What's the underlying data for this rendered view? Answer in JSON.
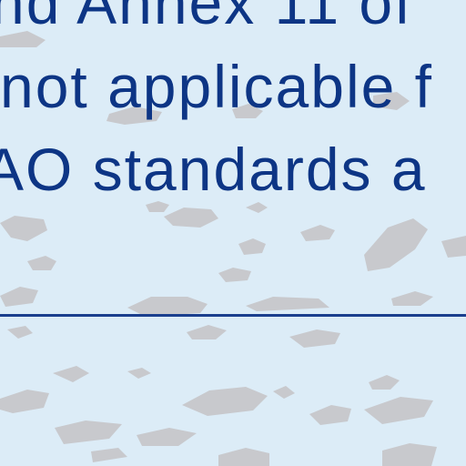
{
  "document": {
    "lines": [
      "nd Annex 11 of",
      "not applicable f",
      "AO standards a"
    ]
  },
  "colors": {
    "background": "#dcecf7",
    "text": "#0d3585",
    "rule": "#1b3f8e",
    "speckle": "#c8c9cd"
  }
}
